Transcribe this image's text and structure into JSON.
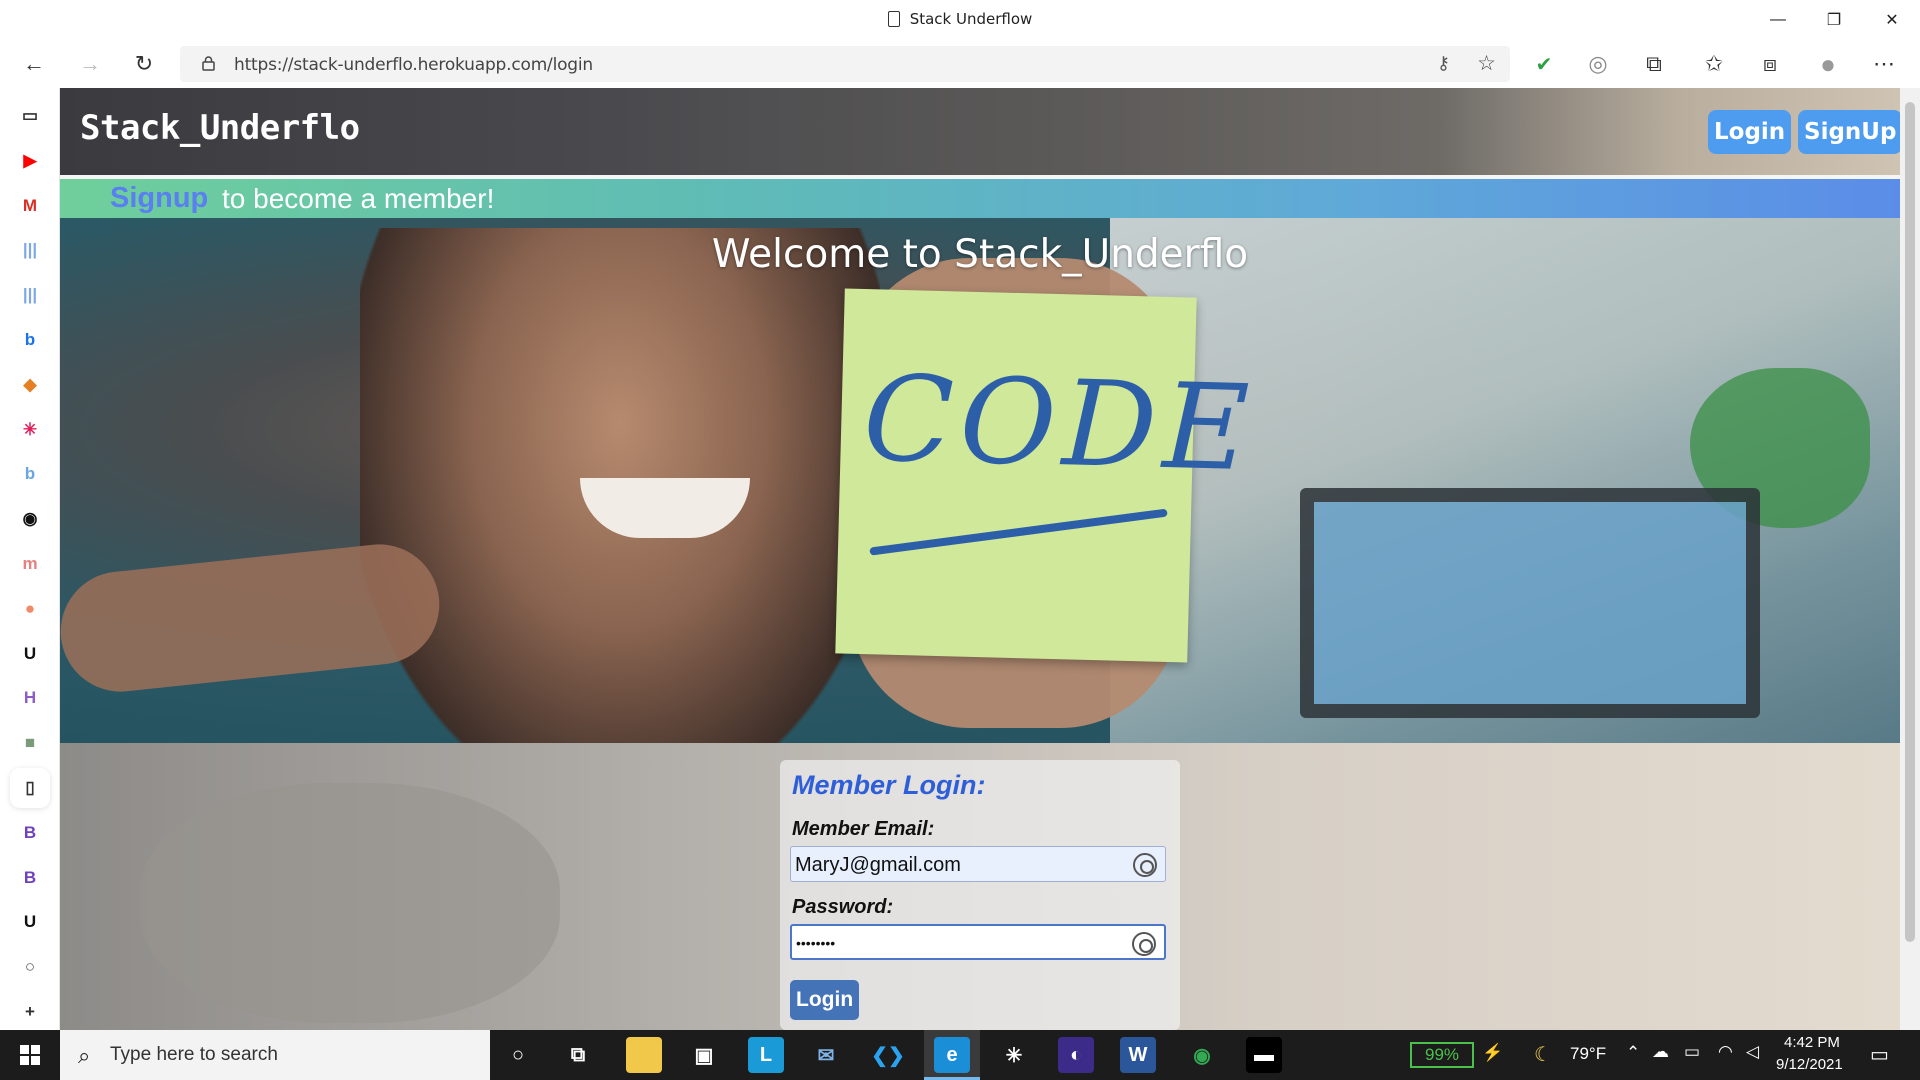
{
  "window": {
    "title": "Stack Underflow",
    "minimize": "—",
    "restore": "❐",
    "close": "✕"
  },
  "browser": {
    "back": "←",
    "forward": "→",
    "refresh": "↻",
    "url": "https://stack-underflo.herokuapp.com/login",
    "key_icon": "⚷",
    "favorite_icon": "☆",
    "extensions": [
      "✔",
      "◎",
      "⧉",
      "✩",
      "⧈",
      "●",
      "⋯"
    ]
  },
  "vtabs": [
    {
      "glyph": "▭",
      "color": "#333333"
    },
    {
      "glyph": "▶",
      "color": "#ff0000"
    },
    {
      "glyph": "M",
      "color": "#d93025"
    },
    {
      "glyph": "|||",
      "color": "#7fa7e8"
    },
    {
      "glyph": "|||",
      "color": "#7fa7e8"
    },
    {
      "glyph": "b",
      "color": "#1a73e8"
    },
    {
      "glyph": "◆",
      "color": "#e67e22"
    },
    {
      "glyph": "✳",
      "color": "#e01e5a"
    },
    {
      "glyph": "b",
      "color": "#6aa7e0"
    },
    {
      "glyph": "◉",
      "color": "#111111"
    },
    {
      "glyph": "m",
      "color": "#e87f7f"
    },
    {
      "glyph": "●",
      "color": "#f08a6a"
    },
    {
      "glyph": "U",
      "color": "#111111"
    },
    {
      "glyph": "H",
      "color": "#8e5cc9"
    },
    {
      "glyph": "■",
      "color": "#7a9a7a"
    },
    {
      "glyph": "▯",
      "color": "#333333"
    },
    {
      "glyph": "B",
      "color": "#6f42c1"
    },
    {
      "glyph": "B",
      "color": "#6f42c1"
    },
    {
      "glyph": "U",
      "color": "#111111"
    },
    {
      "glyph": "○",
      "color": "#555555"
    },
    {
      "glyph": "+",
      "color": "#333333"
    }
  ],
  "site": {
    "brand": "Stack_Underflo",
    "nav": {
      "login": "Login",
      "signup": "SignUp"
    },
    "banner": {
      "link": "Signup",
      "text": "to become a member!"
    },
    "hero": {
      "welcome": "Welcome to Stack_Underflo",
      "note_text": "CODE"
    },
    "login_form": {
      "heading": "Member Login:",
      "email_label": "Member Email:",
      "email_value": "MaryJ@gmail.com",
      "password_label": "Password:",
      "password_value": "••••••••",
      "submit": "Login"
    }
  },
  "taskbar": {
    "search_placeholder": "Type here to search",
    "battery": "99%",
    "weather": "79°F",
    "time": "4:42 PM",
    "date": "9/12/2021",
    "apps": [
      {
        "name": "cortana",
        "glyph": "○",
        "bg": "transparent",
        "color": "#ffffff"
      },
      {
        "name": "task-view",
        "glyph": "⧉",
        "bg": "transparent",
        "color": "#ffffff"
      },
      {
        "name": "file-explorer",
        "glyph": "▬",
        "bg": "#f2c84b",
        "color": "#f2c84b"
      },
      {
        "name": "store",
        "glyph": "▣",
        "bg": "transparent",
        "color": "#ffffff"
      },
      {
        "name": "l-app",
        "glyph": "L",
        "bg": "#1a9bd7",
        "color": "#ffffff"
      },
      {
        "name": "mail",
        "glyph": "✉",
        "bg": "transparent",
        "color": "#7fb3e6"
      },
      {
        "name": "vscode",
        "glyph": "❮❯",
        "bg": "transparent",
        "color": "#2aa3f0"
      },
      {
        "name": "edge",
        "glyph": "e",
        "bg": "#1a8fd8",
        "color": "#ffffff"
      },
      {
        "name": "slack",
        "glyph": "✳",
        "bg": "transparent",
        "color": "#ffffff"
      },
      {
        "name": "circle-app",
        "glyph": "◐",
        "bg": "#3d2b8a",
        "color": "#ffffff"
      },
      {
        "name": "word",
        "glyph": "W",
        "bg": "#2b579a",
        "color": "#ffffff"
      },
      {
        "name": "chrome",
        "glyph": "◉",
        "bg": "transparent",
        "color": "#34a853"
      },
      {
        "name": "terminal",
        "glyph": "▬",
        "bg": "#000000",
        "color": "#ffffff"
      }
    ]
  }
}
